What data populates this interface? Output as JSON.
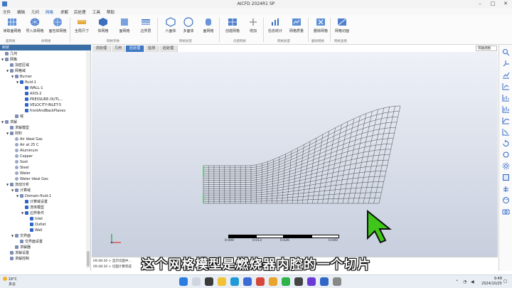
{
  "app": {
    "title": "AICFD 2024R1 SP",
    "menu": [
      "文件",
      "编辑",
      "几何",
      "网格",
      "求解",
      "后处理",
      "工具",
      "帮助"
    ],
    "active_menu_index": 3
  },
  "ribbon": {
    "buttons": [
      "读取面网格",
      "导入体网格",
      "面包体网格",
      "全局尺寸",
      "体网格",
      "面网格",
      "边界层",
      "边界条件",
      "六面体",
      "多面体",
      "面网格",
      "创建网格",
      "增加",
      "信息统计",
      "网格质量",
      "删除网格",
      "网格切面"
    ],
    "groups": [
      "面网格",
      "体网格",
      "网格参数",
      "网格加密",
      "创建网格",
      "网格质量",
      "删除网格",
      "网格查看"
    ]
  },
  "left_panel": {
    "header": "树状",
    "tree": [
      {
        "label": "几何",
        "level": 0
      },
      {
        "label": "网格",
        "level": 0
      },
      {
        "label": "加密区域",
        "level": 1
      },
      {
        "label": "网格域",
        "level": 1
      },
      {
        "label": "Burner",
        "level": 2
      },
      {
        "label": "fluid-1",
        "level": 3
      },
      {
        "label": "WALL-1",
        "level": 4
      },
      {
        "label": "AXIS-2",
        "level": 4
      },
      {
        "label": "PRESSURE-OUTL...",
        "level": 4
      },
      {
        "label": "VELOCITY-INLET-5",
        "level": 4
      },
      {
        "label": "frontAndBackPlanes",
        "level": 4
      },
      {
        "label": "域",
        "level": 2
      },
      {
        "label": "求解",
        "level": 0
      },
      {
        "label": "求解模型",
        "level": 1
      },
      {
        "label": "材料",
        "level": 1
      },
      {
        "label": "Air Ideal Gas",
        "level": 2
      },
      {
        "label": "Air at 25 C",
        "level": 2
      },
      {
        "label": "Aluminum",
        "level": 2
      },
      {
        "label": "Copper",
        "level": 2
      },
      {
        "label": "Soot",
        "level": 2
      },
      {
        "label": "Steel",
        "level": 2
      },
      {
        "label": "Water",
        "level": 2
      },
      {
        "label": "Water Ideal Gas",
        "level": 2
      },
      {
        "label": "流动分析",
        "level": 1
      },
      {
        "label": "计算域",
        "level": 2
      },
      {
        "label": "Domain-fluid-1",
        "level": 3
      },
      {
        "label": "计算域设置",
        "level": 4
      },
      {
        "label": "流体模型",
        "level": 4
      },
      {
        "label": "边界条件",
        "level": 4
      },
      {
        "label": "Inlet",
        "level": 5
      },
      {
        "label": "Outlet",
        "level": 5
      },
      {
        "label": "Wall",
        "level": 5
      },
      {
        "label": "交界面",
        "level": 2
      },
      {
        "label": "交界面设置",
        "level": 3
      },
      {
        "label": "求解器",
        "level": 2
      },
      {
        "label": "求解设置",
        "level": 1
      },
      {
        "label": "求解控制",
        "level": 1
      }
    ]
  },
  "view_tabs": [
    "前处理",
    "几何",
    "后处理",
    "监测",
    "后处理"
  ],
  "active_tab_index": 2,
  "view_select": "等轴测图",
  "scale_bar": [
    "0.000",
    "0.013",
    "0.026",
    "0.040"
  ],
  "console": [
    "09:48:30 > 显示切面中...",
    "09:48:30 > 切面计算完成"
  ],
  "subtitle": "这个网格模型是燃烧器内腔的一个切片",
  "taskbar": {
    "weather_temp": "19°C",
    "weather_desc": "多云",
    "time": "9:48",
    "date": "2024/10/25"
  },
  "colors": {
    "accent": "#3d78c5",
    "mesh": "#3a3a3a",
    "inlet": "#2bd94a",
    "cursor": "#3ec71a"
  }
}
